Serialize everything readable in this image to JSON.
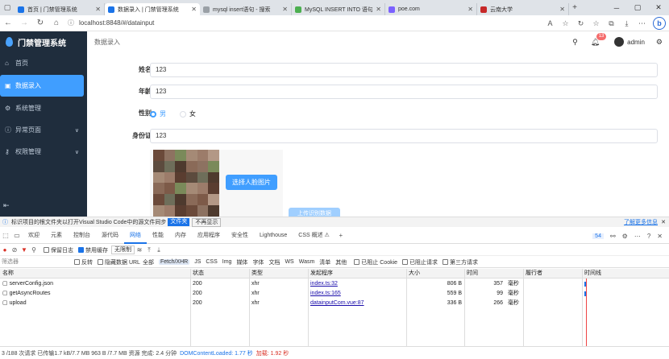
{
  "browser": {
    "tabs": [
      {
        "title": "首页 | 门禁管理系统",
        "favicon_color": "#1a73e8",
        "active": false
      },
      {
        "title": "数据录入 | 门禁管理系统",
        "favicon_color": "#1a73e8",
        "active": true
      },
      {
        "title": "mysql insert语句 - 搜索",
        "favicon_color": "#9aa0a6",
        "active": false
      },
      {
        "title": "MySQL INSERT INTO 语句",
        "favicon_color": "#4caf50",
        "active": false
      },
      {
        "title": "poe.com",
        "favicon_color": "#7b61ff",
        "active": false
      },
      {
        "title": "云南大学",
        "favicon_color": "#c62828",
        "active": false
      }
    ],
    "url": "localhost:8848/#/datainput"
  },
  "app": {
    "title": "门禁管理系统",
    "menu": [
      {
        "label": "首页",
        "icon": "home-icon",
        "glyph": "⌂",
        "active": false,
        "expandable": false
      },
      {
        "label": "数据录入",
        "icon": "id-card-icon",
        "glyph": "▣",
        "active": true,
        "expandable": false
      },
      {
        "label": "系统管理",
        "icon": "gear-icon",
        "glyph": "⚙",
        "active": false,
        "expandable": false
      },
      {
        "label": "异常页面",
        "icon": "warning-icon",
        "glyph": "ⓘ",
        "active": false,
        "expandable": true
      },
      {
        "label": "权限管理",
        "icon": "key-icon",
        "glyph": "⚷",
        "active": false,
        "expandable": true
      }
    ],
    "breadcrumb": "数据录入",
    "notification_count": "13",
    "username": "admin",
    "accent": "#409eff",
    "sidebar_bg": "#1f2d3d"
  },
  "form": {
    "name_label": "姓名",
    "name_value": "123",
    "age_label": "年龄",
    "age_value": "123",
    "gender_label": "性别",
    "gender_male": "男",
    "gender_female": "女",
    "idcard_label": "身份证",
    "idcard_value": "123",
    "upload_button": "选择人脸图片",
    "submit_button": "上传识别数据"
  },
  "notify": {
    "text": "标识项目的根文件夹以打开Visual Studio Code中的源文件同步",
    "btn_primary": "文件夹",
    "btn_secondary": "不再显示",
    "more": "了解更多信息"
  },
  "devtools": {
    "tabs": [
      "欢迎",
      "元素",
      "控制台",
      "源代码",
      "网络",
      "性能",
      "内存",
      "应用程序",
      "安全性",
      "Lighthouse",
      "CSS 概述 ⚠"
    ],
    "active_tab": "网络",
    "issues_count": "54",
    "toolbar": {
      "preserve_log": "保留日志",
      "disable_cache": "禁用缓存",
      "throttle": "无限制"
    },
    "filter": {
      "placeholder": "筛选器",
      "invert": "反转",
      "hide_data_urls": "隐藏数据 URL",
      "types": [
        "全部",
        "Fetch/XHR",
        "JS",
        "CSS",
        "Img",
        "媒体",
        "字体",
        "文档",
        "WS",
        "Wasm",
        "清单",
        "其他"
      ],
      "active_type": "Fetch/XHR",
      "blocked_cookies": "已阻止 Cookie",
      "blocked_requests": "已阻止请求",
      "third_party": "第三方请求"
    },
    "columns": [
      "名称",
      "状态",
      "类型",
      "发起程序",
      "大小",
      "时间",
      "履行者",
      "时间线"
    ],
    "rows": [
      {
        "name": "serverConfig.json",
        "status": "200",
        "type": "xhr",
        "initiator": "index.ts:32",
        "size": "806 B",
        "time": "357",
        "time_unit": "毫秒"
      },
      {
        "name": "getAsyncRoutes",
        "status": "200",
        "type": "xhr",
        "initiator": "index.ts:165",
        "size": "559 B",
        "time": "99",
        "time_unit": "毫秒"
      },
      {
        "name": "upload",
        "status": "200",
        "type": "xhr",
        "initiator": "datainputCom.vue:87",
        "size": "336 B",
        "time": "266",
        "time_unit": "毫秒"
      }
    ],
    "status_summary": "3 /188 次请求  已传输1.7 kB/7.7 MB  963 B /7.7 MB 资源  完成: 2.4 分钟",
    "dom_loaded": "DOMContentLoaded: 1.77 秒",
    "load": "加载: 1.92 秒"
  }
}
